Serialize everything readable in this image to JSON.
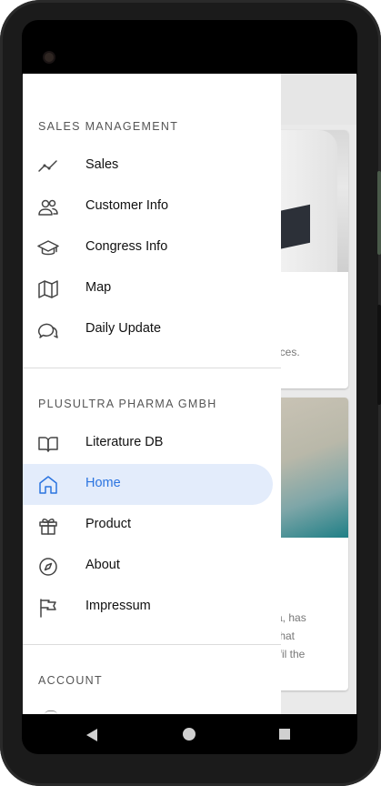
{
  "drawer": {
    "sections": [
      {
        "title": "SALES MANAGEMENT",
        "items": [
          {
            "label": "Sales",
            "icon": "trending-up-icon"
          },
          {
            "label": "Customer Info",
            "icon": "users-icon"
          },
          {
            "label": "Congress Info",
            "icon": "graduation-cap-icon"
          },
          {
            "label": "Map",
            "icon": "map-icon"
          },
          {
            "label": "Daily Update",
            "icon": "chat-bubbles-icon"
          }
        ]
      },
      {
        "title": "PLUSULTRA PHARMA GMBH",
        "items": [
          {
            "label": "Literature DB",
            "icon": "book-open-icon"
          },
          {
            "label": "Home",
            "icon": "home-icon",
            "active": true
          },
          {
            "label": "Product",
            "icon": "gift-icon"
          },
          {
            "label": "About",
            "icon": "compass-icon"
          },
          {
            "label": "Impressum",
            "icon": "flag-icon"
          }
        ]
      },
      {
        "title": "ACCOUNT",
        "items": []
      }
    ]
  },
  "background": {
    "card1_lines": [
      "t",
      "ices."
    ],
    "card2_lines": [
      "a, has",
      "that",
      "lfil the"
    ]
  },
  "colors": {
    "accent": "#2b74e0",
    "active_bg": "#e3ecfb"
  },
  "nav": {
    "back": "back-icon",
    "home": "home-circle-icon",
    "recents": "recents-icon"
  }
}
